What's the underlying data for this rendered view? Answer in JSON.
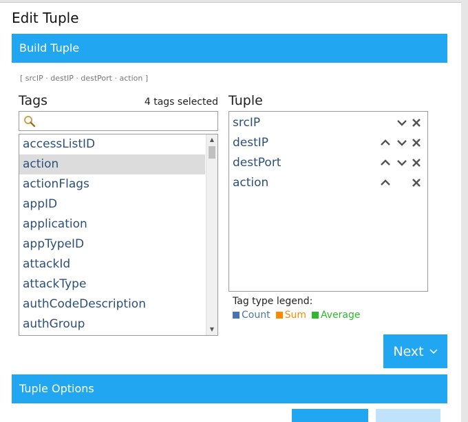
{
  "dialog": {
    "title": "Edit Tuple"
  },
  "build_section": {
    "title": "Build Tuple",
    "summary": "[ srcIP · destIP · destPort · action ]"
  },
  "tags": {
    "label": "Tags",
    "selected_count": "4 tags selected",
    "search_value": "",
    "items": [
      "accessListID",
      "action",
      "actionFlags",
      "appID",
      "application",
      "appTypeID",
      "attackId",
      "attackType",
      "authCodeDescription",
      "authGroup"
    ],
    "highlighted": "action"
  },
  "tuple": {
    "label": "Tuple",
    "items": [
      {
        "name": "srcIP",
        "up": false,
        "down": true
      },
      {
        "name": "destIP",
        "up": true,
        "down": true
      },
      {
        "name": "destPort",
        "up": true,
        "down": true
      },
      {
        "name": "action",
        "up": true,
        "down": false
      }
    ]
  },
  "legend": {
    "title": "Tag type legend:",
    "items": [
      {
        "label": "Count",
        "color": "#4a74ad"
      },
      {
        "label": "Sum",
        "color": "#ff8a00"
      },
      {
        "label": "Average",
        "color": "#2db82d"
      }
    ]
  },
  "next_button": {
    "label": "Next"
  },
  "options_section": {
    "title": "Tuple Options"
  },
  "colors": {
    "accent": "#21a6f2",
    "accent_disabled": "#bfe3fb",
    "link_text": "#2d4f7a"
  }
}
